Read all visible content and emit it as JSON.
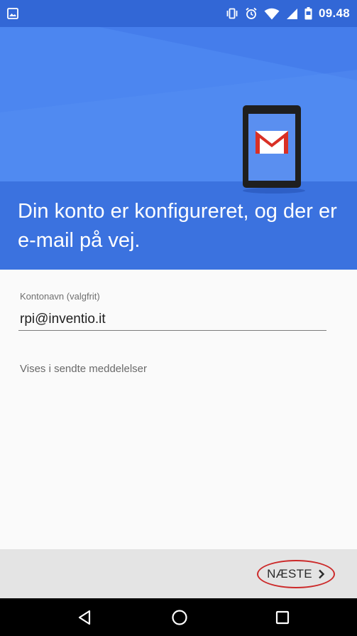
{
  "status_bar": {
    "time": "09.48",
    "icons": [
      "image-icon",
      "vibrate-icon",
      "alarm-icon",
      "wifi-icon",
      "cell-signal-icon",
      "battery-icon"
    ]
  },
  "hero": {
    "title": "Din konto er konfigureret, og der er e-mail på vej.",
    "illustration": "gmail-phone-icon"
  },
  "form": {
    "account_name_label": "Kontonavn (valgfrit)",
    "account_name_value": "rpi@inventio.it",
    "helper_text": "Vises i sendte meddelelser"
  },
  "footer": {
    "next_label": "NÆSTE",
    "next_icon": "chevron-right-icon"
  },
  "nav": {
    "icons": [
      "back-icon",
      "home-icon",
      "recents-icon"
    ]
  },
  "colors": {
    "status_bar": "#3267d6",
    "hero": "#4c86f0",
    "accent_highlight": "#cc2a2a",
    "footer": "#e4e4e4"
  }
}
